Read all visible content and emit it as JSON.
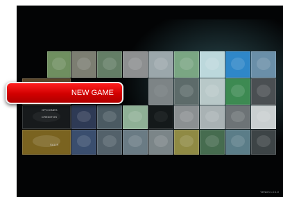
{
  "menu": {
    "selected_label": "NEW GAME",
    "items": [
      {
        "label": "OPCIONES"
      },
      {
        "label": "CREDITOS"
      },
      {
        "label": "SALIR"
      }
    ]
  },
  "footer": {
    "version": "Versión 1.0.1.0"
  },
  "colors": {
    "highlight": "#e00000",
    "background": "#030405"
  }
}
